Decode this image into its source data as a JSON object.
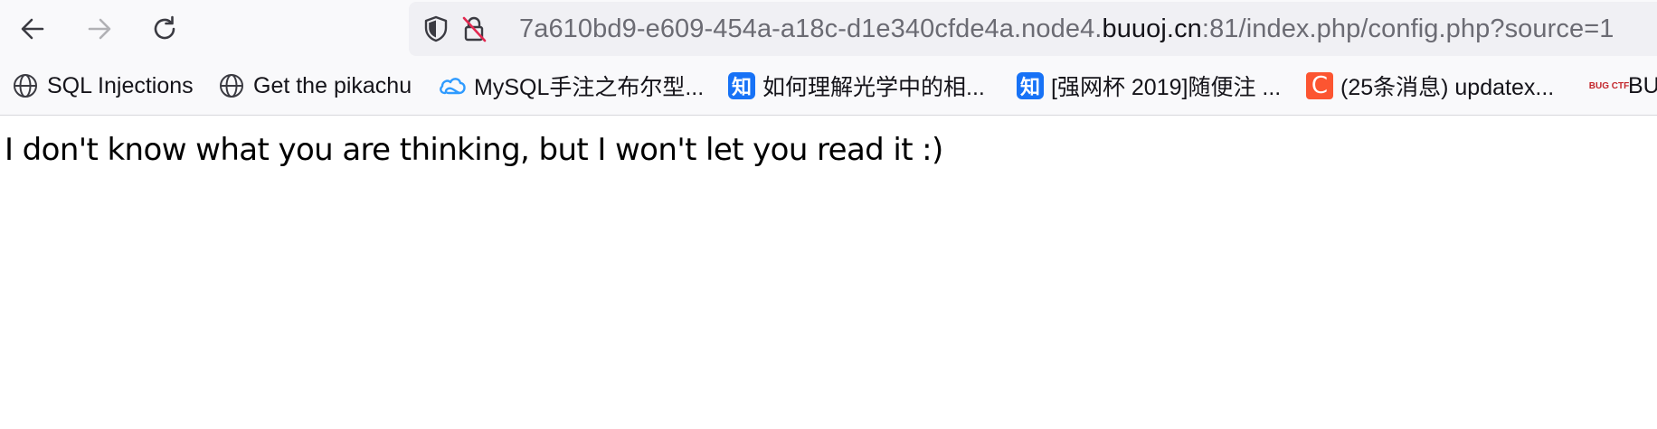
{
  "toolbar": {
    "back_icon": "arrow-left-icon",
    "forward_icon": "arrow-right-icon",
    "reload_icon": "reload-icon",
    "forward_enabled": false
  },
  "urlbar": {
    "shield_icon": "tracking-protection-shield-icon",
    "insecure_icon": "insecure-lock-icon",
    "url_prefix": "7a610bd9-e609-454a-a18c-d1e340cfde4a.node4.",
    "url_domain": "buuoj.cn",
    "url_suffix": ":81/index.php/config.php?source=1"
  },
  "bookmarks": [
    {
      "label": "SQL Injections",
      "icon": "globe-icon"
    },
    {
      "label": "Get the pikachu",
      "icon": "globe-icon"
    },
    {
      "label": "MySQL手注之布尔型...",
      "icon": "cloud-icon"
    },
    {
      "label": "如何理解光学中的相...",
      "icon": "zhihu-icon",
      "icon_text": "知"
    },
    {
      "label": "[强网杯 2019]随便注 ...",
      "icon": "zhihu-icon",
      "icon_text": "知"
    },
    {
      "label": "(25条消息) updatex...",
      "icon": "csdn-icon",
      "icon_text": "C"
    },
    {
      "label": "BU",
      "icon": "bugku-icon",
      "icon_text": "BUG CTF"
    }
  ],
  "page": {
    "message": "I don't know what you are thinking, but I won't let you read it :)"
  },
  "colors": {
    "toolbar_bg": "#f9f9fb",
    "urlbar_bg": "#f0f0f4",
    "zhihu_blue": "#1772f6",
    "csdn_orange": "#fc5531",
    "cloud_blue": "#2f9bff"
  }
}
